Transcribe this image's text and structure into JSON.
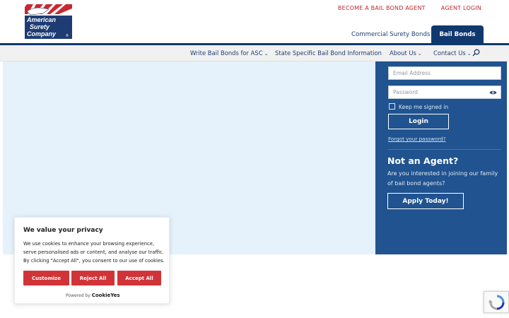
{
  "logo": {
    "line1": "American",
    "line2": "Surety",
    "line3": "Company",
    "mark": "®"
  },
  "top_links": [
    "BECOME A BAIL BOND AGENT",
    "AGENT LOGIN"
  ],
  "tabs": {
    "commercial": "Commercial Surety Bonds",
    "bail": "Bail Bonds"
  },
  "nav": {
    "items": [
      {
        "label": "Write Bail Bonds for ASC",
        "has_dropdown": true
      },
      {
        "label": "State Specific Bail Bond Information",
        "has_dropdown": false
      },
      {
        "label": "About Us",
        "has_dropdown": true
      },
      {
        "label": "Contact Us",
        "has_dropdown": true
      }
    ],
    "search_icon": "search-icon",
    "chevron": "⌄"
  },
  "login": {
    "email_placeholder": "Email Address",
    "password_placeholder": "Password",
    "keep_signed_in": "Keep me signed in",
    "login_button": "Login",
    "forgot": "Forgot your password?"
  },
  "promo": {
    "title": "Not an Agent?",
    "text": "Are you interested in joining our family of bail bond agents?",
    "button": "Apply Today!"
  },
  "cookie": {
    "title": "We value your privacy",
    "text": "We use cookies to enhance your browsing experience, serve personalised ads or content, and analyse our traffic. By clicking \"Accept All\", you consent to our use of cookies.",
    "customize": "Customize",
    "reject": "Reject All",
    "accept": "Accept All",
    "powered_by": "Powered by",
    "brand": "CookieYes"
  },
  "colors": {
    "navy": "#10386f",
    "sidebar_blue": "#20538f",
    "hero_bg": "#e5f1fb",
    "red": "#c0282d",
    "cookie_red": "#d13438"
  }
}
